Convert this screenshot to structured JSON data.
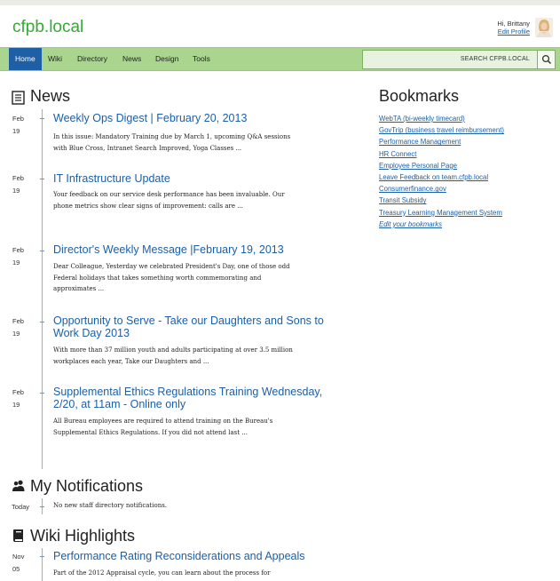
{
  "site": {
    "title": "cfpb.local"
  },
  "user": {
    "greeting": "Hi, Brittany",
    "edit_profile": "Edit Profile"
  },
  "nav": {
    "items": [
      {
        "label": "Home",
        "active": true
      },
      {
        "label": "Wiki",
        "active": false
      },
      {
        "label": "Directory",
        "active": false
      },
      {
        "label": "News",
        "active": false
      },
      {
        "label": "Design",
        "active": false
      },
      {
        "label": "Tools",
        "active": false
      }
    ],
    "search_placeholder": "SEARCH CFPB.LOCAL",
    "search_icon": "search-icon"
  },
  "news": {
    "heading": "News",
    "icon": "newspaper-icon",
    "items": [
      {
        "month": "Feb",
        "day": "19",
        "title": "Weekly Ops Digest | February 20, 2013",
        "excerpt": "In this issue: Mandatory Training due by March 1, upcoming Q&A sessions with Blue Cross, Intranet Search Improved, Yoga Classes ..."
      },
      {
        "month": "Feb",
        "day": "19",
        "title": "IT Infrastructure Update",
        "excerpt": "Your feedback on our service desk performance has been invaluable. Our phone metrics show clear signs of improvement: calls are ..."
      },
      {
        "month": "Feb",
        "day": "19",
        "title": "Director's Weekly Message |February 19, 2013",
        "excerpt": "Dear Colleague, Yesterday we celebrated President's Day, one of those odd Federal holidays that takes something worth commemorating and approximates ..."
      },
      {
        "month": "Feb",
        "day": "19",
        "title": "Opportunity to Serve - Take our Daughters and Sons to Work Day 2013",
        "excerpt": "With more than 37 million youth and adults participating at over 3.5 million workplaces each year, Take our Daughters and ..."
      },
      {
        "month": "Feb",
        "day": "19",
        "title": "Supplemental Ethics Regulations Training Wednesday, 2/20, at 11am - Online only",
        "excerpt": "All Bureau employees are required to attend training on the Bureau's Supplemental Ethics Regulations. If you did not attend last ..."
      }
    ]
  },
  "notifications": {
    "heading": "My Notifications",
    "icon": "users-icon",
    "items": [
      {
        "date": "Today",
        "text": "No new staff directory notifications."
      }
    ]
  },
  "wiki": {
    "heading": "Wiki Highlights",
    "icon": "book-icon",
    "items": [
      {
        "month": "Nov",
        "day": "05",
        "title": "Performance Rating Reconsiderations and Appeals",
        "excerpt": "Part of the 2012 Appraisal cycle, you can learn about the process for"
      }
    ]
  },
  "bookmarks": {
    "heading": "Bookmarks",
    "links": [
      "WebTA (bi-weekly timecard)",
      "GovTrip (business travel reimbursement)",
      "Performance Management",
      "HR Connect",
      "Employee Personal Page",
      "Leave Feedback on team.cfpb.local",
      "Consumerfinance.gov",
      "Transit Subsidy",
      "Treasury Learning Management System"
    ],
    "edit_label": "Edit your bookmarks"
  },
  "colors": {
    "brand_green": "#38a838",
    "nav_bg": "#a9d58e",
    "nav_active": "#1f5fa6",
    "link": "#1b5fa8"
  }
}
